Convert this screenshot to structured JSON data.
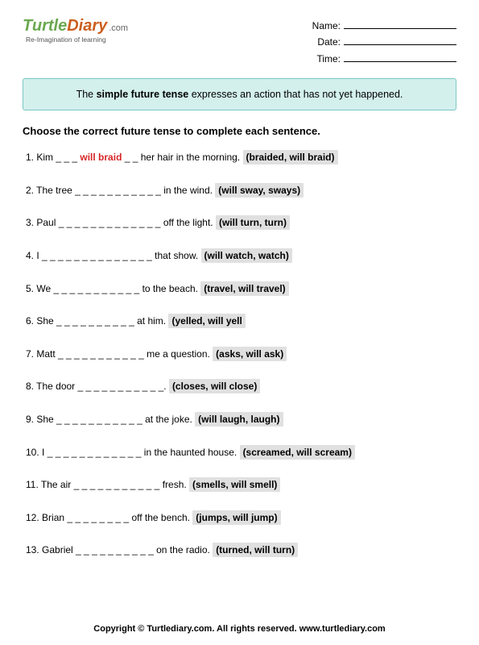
{
  "header": {
    "logo": {
      "word1": "Turtle",
      "word2": "Diary",
      "dotcom": ".com",
      "tagline": "Re-Imagination of learning"
    },
    "fields": {
      "name": "Name:",
      "date": "Date:",
      "time": "Time:"
    }
  },
  "info": {
    "pre": "The ",
    "bold": "simple future tense",
    "post": " expresses an action that has not yet happened."
  },
  "instruction": "Choose the correct future tense to complete each sentence.",
  "questions": [
    {
      "num": "1.",
      "pre": " Kim _ _ _ ",
      "answer": "will braid",
      "post": " _ _ her hair in the morning. ",
      "choices": "(braided, will braid)"
    },
    {
      "num": "2.",
      "text": " The tree _ _ _ _ _ _ _ _ _ _ _ in the wind. ",
      "choices": "(will sway, sways)"
    },
    {
      "num": "3.",
      "text": " Paul _ _ _ _ _ _ _ _ _ _ _ _ _ off the light. ",
      "choices": "(will turn, turn)"
    },
    {
      "num": "4.",
      "text": " I _ _ _ _ _ _ _ _ _ _ _ _ _ _ that show. ",
      "choices": "(will watch, watch)"
    },
    {
      "num": "5.",
      "text": " We _ _ _ _ _ _ _ _ _ _ _ to the beach. ",
      "choices": "(travel, will travel)"
    },
    {
      "num": "6.",
      "text": " She _ _ _ _ _ _ _ _ _ _ at him. ",
      "choices": "(yelled, will yell"
    },
    {
      "num": "7.",
      "text": " Matt _ _ _ _ _ _ _ _ _ _ _ me a question. ",
      "choices": "(asks, will ask)"
    },
    {
      "num": "8.",
      "text": " The door _ _ _ _ _ _ _ _ _ _ _. ",
      "choices": "(closes, will close)"
    },
    {
      "num": "9.",
      "text": " She _ _ _ _ _ _ _ _ _ _ _ at the joke. ",
      "choices": "(will laugh, laugh)"
    },
    {
      "num": "10.",
      "text": " I _ _ _ _ _ _ _ _ _ _ _ _ in the haunted house. ",
      "choices": "(screamed, will scream)"
    },
    {
      "num": "11.",
      "text": " The air _ _ _ _ _ _ _ _ _ _ _ fresh. ",
      "choices": "(smells, will smell)"
    },
    {
      "num": "12.",
      "text": " Brian _ _ _ _ _ _ _ _ off the bench. ",
      "choices": "(jumps, will jump)"
    },
    {
      "num": "13.",
      "text": " Gabriel _ _ _ _ _ _ _ _ _ _ on the radio. ",
      "choices": "(turned, will turn)"
    }
  ],
  "footer": "Copyright © Turtlediary.com. All rights reserved. www.turtlediary.com"
}
